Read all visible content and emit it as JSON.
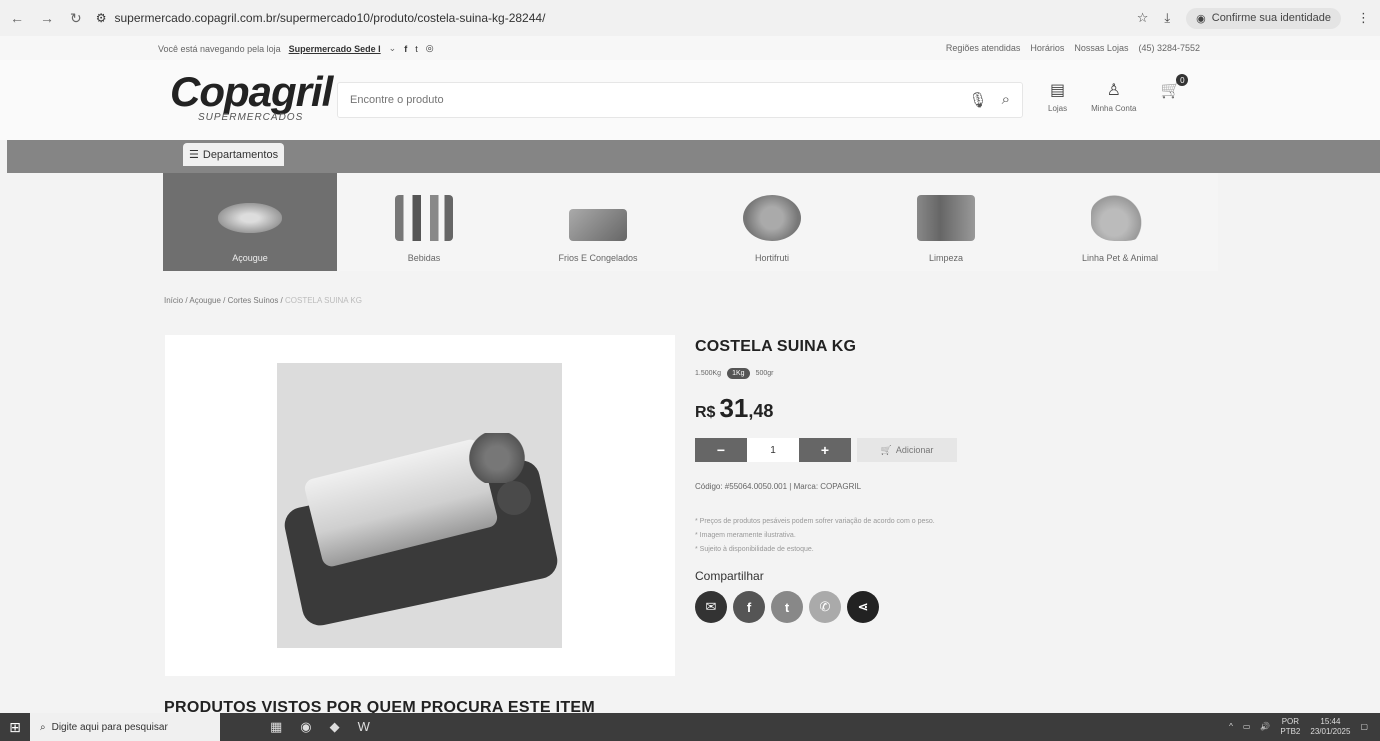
{
  "browser": {
    "url": "supermercado.copagril.com.br/supermercado10/produto/costela-suina-kg-28244/",
    "identity_label": "Confirme sua identidade"
  },
  "topbar": {
    "store_prefix": "Você está navegando pela loja",
    "store_name": "Supermercado Sede I",
    "links": [
      "Regiões atendidas",
      "Horários",
      "Nossas Lojas",
      "(45) 3284-7552"
    ]
  },
  "header": {
    "logo": "Copagril",
    "logo_sub": "SUPERMERCADOS",
    "search_placeholder": "Encontre o produto",
    "stores_label": "Lojas",
    "account_label": "Minha Conta",
    "cart_count": "0"
  },
  "departments_label": "Departamentos",
  "categories": [
    {
      "label": "Açougue"
    },
    {
      "label": "Bebidas"
    },
    {
      "label": "Frios E Congelados"
    },
    {
      "label": "Hortifruti"
    },
    {
      "label": "Limpeza"
    },
    {
      "label": "Linha Pet & Animal"
    }
  ],
  "breadcrumb": {
    "items": [
      "Início",
      "Açougue",
      "Cortes Suínos"
    ],
    "current": "COSTELA SUINA KG"
  },
  "product": {
    "title": "COSTELA SUINA KG",
    "weights": [
      "1.500Kg",
      "1Kg",
      "500gr"
    ],
    "price_currency": "R$",
    "price_int": "31",
    "price_dec": ",48",
    "quantity": "1",
    "add_label": "Adicionar",
    "code_line": "Código: #55064.0050.001 | Marca: COPAGRIL",
    "notes": [
      "* Preços de produtos pesáveis podem sofrer variação de acordo com o peso.",
      "* Imagem meramente ilustrativa.",
      "* Sujeito à disponibilidade de estoque."
    ],
    "share_label": "Compartilhar"
  },
  "recommended_title": "PRODUTOS VISTOS POR QUEM PROCURA ESTE ITEM",
  "taskbar": {
    "search_placeholder": "Digite aqui para pesquisar",
    "lang": "POR",
    "layout": "PTB2",
    "time": "15:44",
    "date": "23/01/2025"
  }
}
